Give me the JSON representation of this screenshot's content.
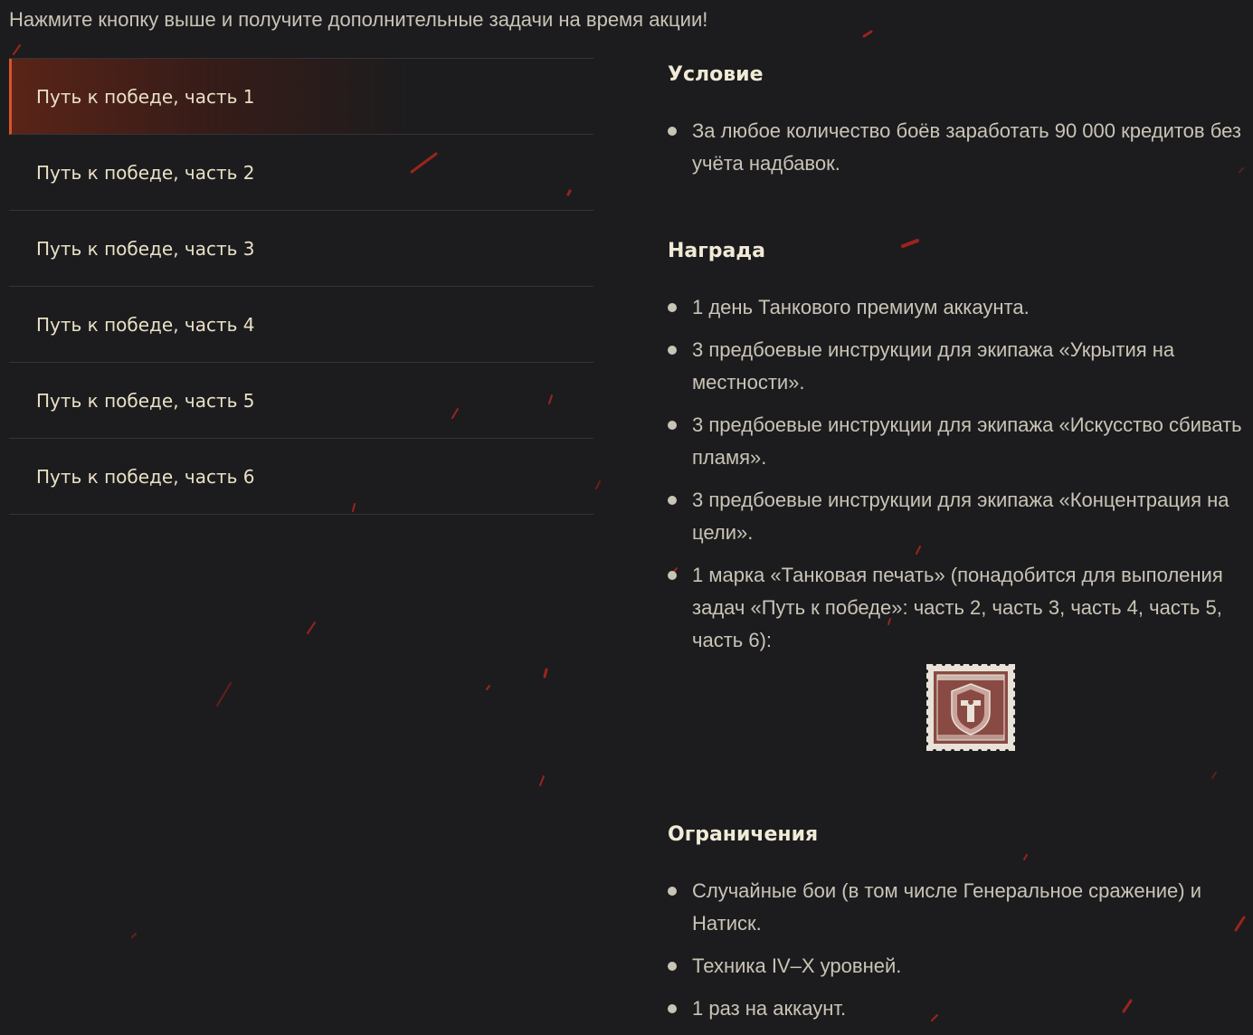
{
  "intro_text": "Нажмите кнопку выше и получите дополнительные задачи на время акции!",
  "tabs": [
    {
      "label": "Путь к победе, часть 1",
      "active": true
    },
    {
      "label": "Путь к победе, часть 2",
      "active": false
    },
    {
      "label": "Путь к победе, часть 3",
      "active": false
    },
    {
      "label": "Путь к победе, часть 4",
      "active": false
    },
    {
      "label": "Путь к победе, часть 5",
      "active": false
    },
    {
      "label": "Путь к победе, часть 6",
      "active": false
    }
  ],
  "condition": {
    "title": "Условие",
    "items": [
      "За любое количество боёв заработать 90 000 кредитов без учёта надбавок."
    ]
  },
  "reward": {
    "title": "Награда",
    "items": [
      "1 день Танкового премиум аккаунта.",
      "3 предбоевые инструкции для экипажа «Укрытия на местности».",
      "3 предбоевые инструкции для экипажа «Искусство сбивать пламя».",
      "3 предбоевые инструкции для экипажа «Концентрация на цели».",
      "1 марка «Танковая печать» (понадобится для выполения задач «Путь к победе»: часть 2, часть 3, часть 4, часть 5, часть 6):"
    ],
    "stamp_icon": "tank-seal-stamp-icon"
  },
  "restrictions": {
    "title": "Ограничения",
    "items": [
      "Случайные бои (в том числе Генеральное сражение) и Натиск.",
      "Техника IV–X уровней.",
      "1 раз на аккаунт."
    ]
  },
  "colors": {
    "background": "#1c1c1e",
    "accent": "#d9532a",
    "tab_text": "#e9e0c6",
    "body_text": "#c9c4b6",
    "heading_text": "#f1ead6",
    "stamp": "#8a4a44"
  }
}
